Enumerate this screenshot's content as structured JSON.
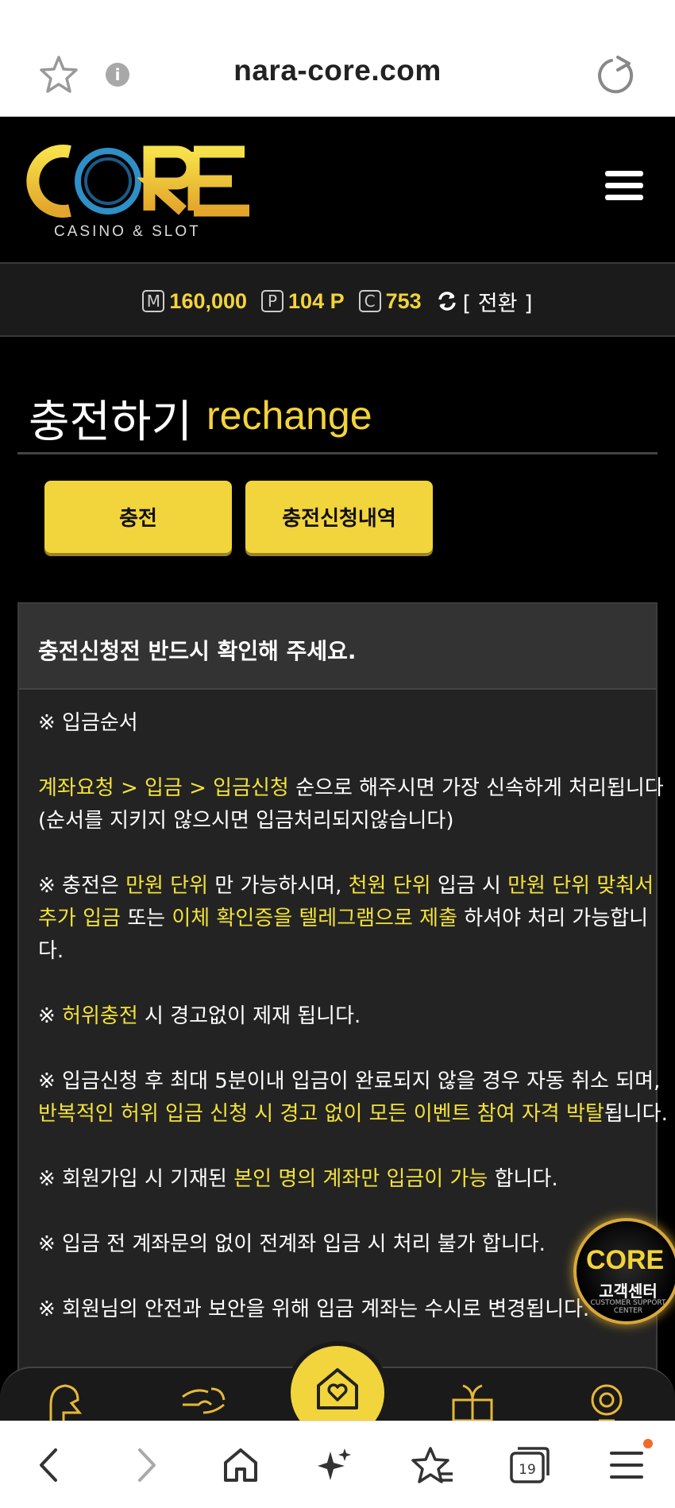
{
  "browser": {
    "url": "nara-core.com",
    "info_glyph": "i",
    "tab_count": "19"
  },
  "site": {
    "logo_text": "CORE",
    "logo_sub": "CASINO & SLOT"
  },
  "balance": {
    "money_badge": "M",
    "money": "160,000",
    "point_badge": "P",
    "point": "104 P",
    "coin_badge": "C",
    "coin": "753",
    "convert_label": "[ 전환 ]"
  },
  "page": {
    "title_ko": "충전하기",
    "title_en": "rechange"
  },
  "tabs": [
    {
      "label": "충전"
    },
    {
      "label": "충전신청내역"
    }
  ],
  "notice": {
    "heading": "충전신청전 반드시 확인해 주세요.",
    "order_title": "※ 입금순서",
    "p1_hl": "계좌요청 > 입금 > 입금신청",
    "p1_rest": " 순으로 해주시면 가장 신속하게 처리됩니다 (순서를 지키지 않으시면 입금처리되지않습니다)",
    "p2_a": "※ 충전은 ",
    "p2_b": "만원 단위",
    "p2_c": " 만 가능하시며, ",
    "p2_d": "천원 단위",
    "p2_e": " 입금 시 ",
    "p2_f": "만원 단위 맞춰서 추가 입금",
    "p2_g": " 또는 ",
    "p2_h": "이체 확인증을 텔레그램으로 제출",
    "p2_i": " 하셔야 처리 가능합니다.",
    "p3_a": "※ ",
    "p3_b": "허위충전",
    "p3_c": " 시 경고없이 제재 됩니다.",
    "p4_a": "※ 입금신청 후 최대 5분이내 입금이 완료되지 않을 경우 자동 취소 되며, ",
    "p4_b": "반복적인 허위 입금 신청 시 경고 없이 모든 이벤트 참여 자격 박탈",
    "p4_c": "됩니다.",
    "p5_a": "※ 회원가입 시 기재된 ",
    "p5_b": "본인 명의 계좌만 입금이 가능",
    "p5_c": " 합니다.",
    "p6": "※ 입금 전 계좌문의 없이 전계좌 입금 시 처리 불가 합니다.",
    "p7": "※ 회원님의 안전과 보안을 위해 입금 계좌는 수시로 변경됩니다."
  },
  "support": {
    "logo": "CORE",
    "label": "고객센터",
    "sub": "CUSTOMER SUPPORT CENTER"
  },
  "colors": {
    "accent": "#f2d43c",
    "highlight_text": "#f3e23a",
    "background": "#000000",
    "panel": "#232323"
  }
}
